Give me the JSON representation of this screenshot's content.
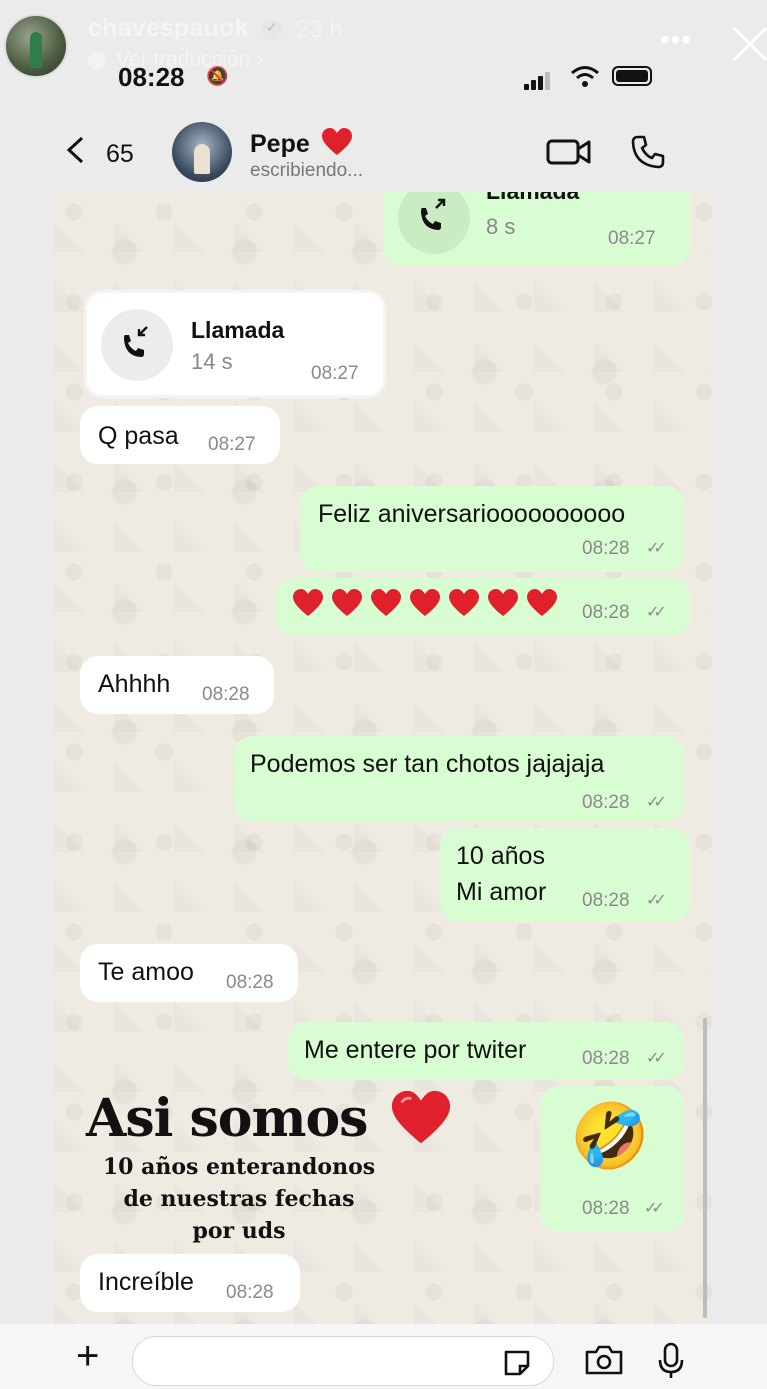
{
  "story": {
    "username": "chavespauok",
    "time_ago": "23 h",
    "translate_label": "Ver traducción",
    "more_label": "•••"
  },
  "status_bar": {
    "time": "08:28"
  },
  "chat_header": {
    "back_count": "65",
    "contact_name": "Pepe",
    "contact_status": "escribiendo..."
  },
  "messages": {
    "call_out": {
      "title": "Llamada",
      "duration": "8 s",
      "time": "08:27"
    },
    "call_in": {
      "title": "Llamada",
      "duration": "14 s",
      "time": "08:27"
    },
    "m1": {
      "text": "Q pasa",
      "time": "08:27"
    },
    "m2": {
      "text": "Feliz aniversarioooooooooo",
      "time": "08:28"
    },
    "m3": {
      "hearts": 7,
      "time": "08:28"
    },
    "m4": {
      "text": "Ahhhh",
      "time": "08:28"
    },
    "m5": {
      "text": "Podemos ser tan chotos jajajaja",
      "time": "08:28"
    },
    "m6": {
      "line1": "10 años",
      "line2": "Mi amor",
      "time": "08:28"
    },
    "m7": {
      "text": "Te amoo",
      "time": "08:28"
    },
    "m8": {
      "text": "Me entere por twiter",
      "time": "08:28"
    },
    "m9": {
      "emoji": "🤣",
      "time": "08:28"
    },
    "m10": {
      "text": "Increíble",
      "time": "08:28"
    }
  },
  "overlay": {
    "title": "Asi somos",
    "line1": "10 años enterandonos",
    "line2": "de nuestras fechas",
    "line3": "por uds"
  },
  "colors": {
    "outgoing": "#d9fdd3",
    "incoming": "#ffffff",
    "heart": "#e0202a"
  }
}
